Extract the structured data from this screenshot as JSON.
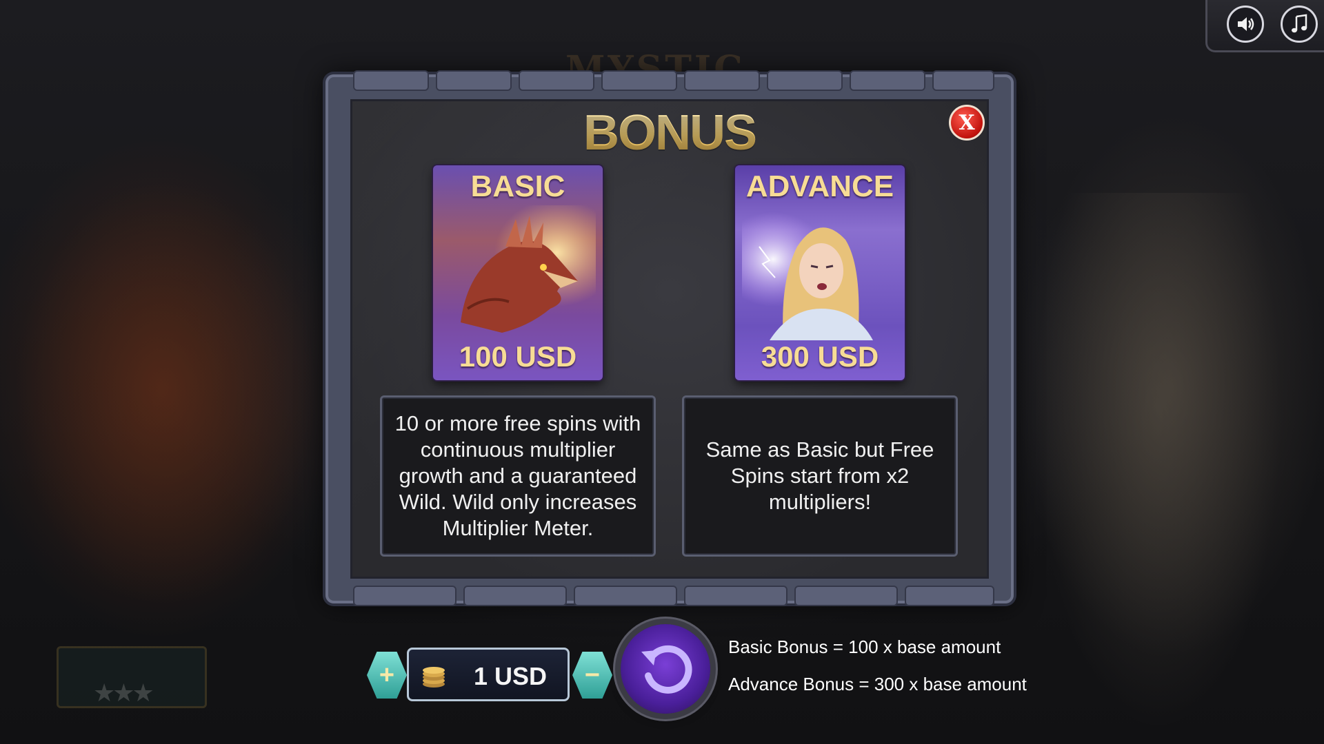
{
  "background": {
    "logo_text": "MYSTIC"
  },
  "audio": {
    "sound_icon": "speaker-icon",
    "music_icon": "music-note-icon"
  },
  "modal": {
    "title": "BONUS",
    "close_label": "X",
    "cards": [
      {
        "name": "BASIC",
        "price": "100 USD",
        "art": "dragon",
        "description": "10 or more free spins with continuous multiplier growth and a guaranteed Wild. Wild only increases Multiplier Meter."
      },
      {
        "name": "ADVANCE",
        "price": "300 USD",
        "art": "sorceress",
        "description": "Same as Basic but Free Spins start from x2 multipliers!"
      }
    ]
  },
  "controls": {
    "plus_label": "+",
    "minus_label": "−",
    "amount": "1 USD",
    "info": [
      "Basic Bonus = 100 x base amount",
      "Advance Bonus = 300 x base amount"
    ]
  },
  "colors": {
    "title_gold": "#f4cf72",
    "card_purple": "#7a55c0",
    "close_red": "#c1120c",
    "spin_purple": "#7a3fd6",
    "hex_teal": "#2f9f96"
  }
}
